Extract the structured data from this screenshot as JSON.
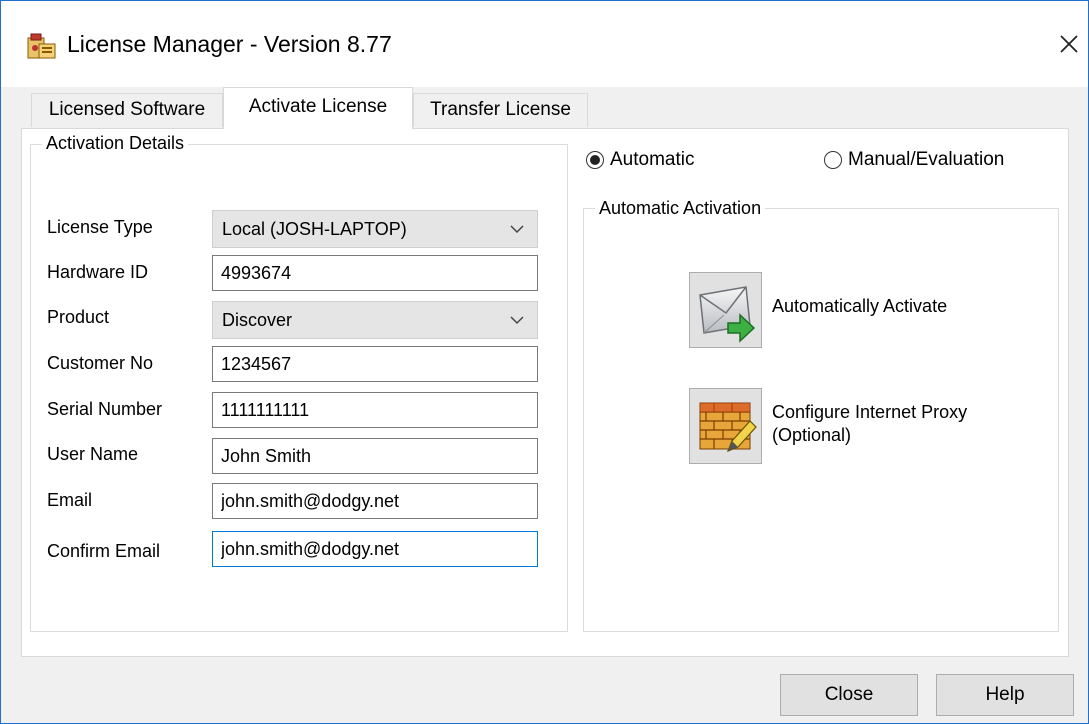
{
  "window": {
    "title": "License Manager - Version 8.77",
    "close_glyph": "✕"
  },
  "tabs": [
    {
      "label": "Licensed Software",
      "active": false
    },
    {
      "label": "Activate License",
      "active": true
    },
    {
      "label": "Transfer License",
      "active": false
    }
  ],
  "activation_details": {
    "legend": "Activation Details",
    "fields": {
      "license_type": {
        "label": "License Type",
        "value": "Local (JOSH-LAPTOP)"
      },
      "hardware_id": {
        "label": "Hardware ID",
        "value": "4993674"
      },
      "product": {
        "label": "Product",
        "value": "Discover"
      },
      "customer_no": {
        "label": "Customer No",
        "value": "1234567"
      },
      "serial_number": {
        "label": "Serial Number",
        "value": "1111111111"
      },
      "user_name": {
        "label": "User Name",
        "value": "John Smith"
      },
      "email": {
        "label": "Email",
        "value": "john.smith@dodgy.net"
      },
      "confirm_email": {
        "label": "Confirm Email",
        "value": "john.smith@dodgy.net"
      }
    }
  },
  "mode": {
    "automatic_label": "Automatic",
    "manual_label": "Manual/Evaluation",
    "selected": "automatic"
  },
  "automatic_activation": {
    "legend": "Automatic Activation",
    "activate_label": "Automatically Activate",
    "proxy_label_line1": "Configure Internet Proxy",
    "proxy_label_line2": "(Optional)",
    "activate_icon": "envelope-arrow-icon",
    "proxy_icon": "firewall-icon"
  },
  "footer": {
    "close_label": "Close",
    "help_label": "Help"
  },
  "colors": {
    "window_border": "#1e6fd0",
    "focus_border": "#0078d7",
    "button_face": "#e1e1e1"
  }
}
